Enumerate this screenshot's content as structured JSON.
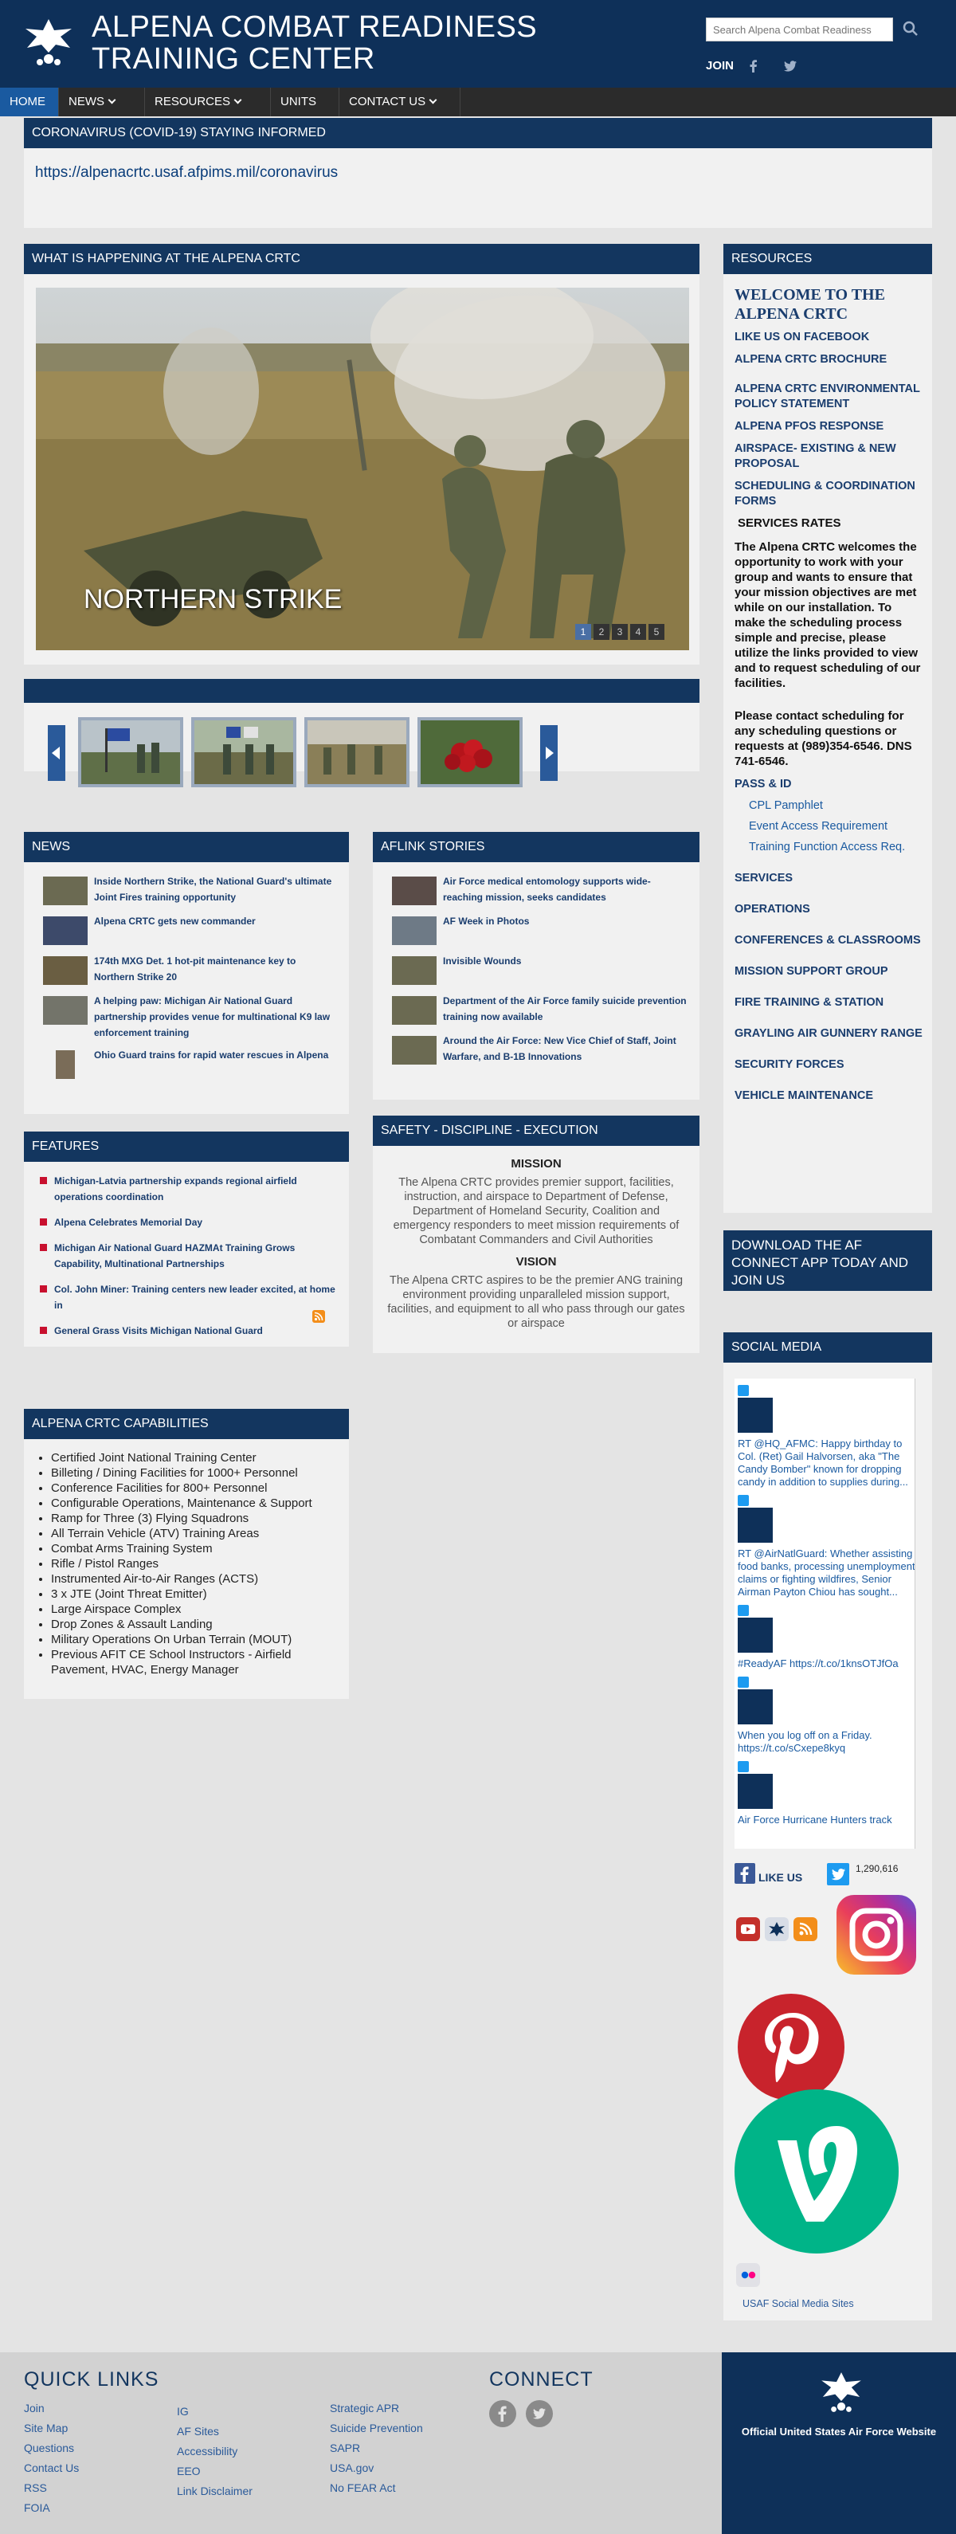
{
  "header": {
    "title": "ALPENA COMBAT READINESS TRAINING CENTER",
    "search_placeholder": "Search Alpena Combat Readiness",
    "join_label": "JOIN"
  },
  "nav": {
    "items": [
      {
        "label": "HOME",
        "active": true
      },
      {
        "label": "NEWS",
        "dropdown": true
      },
      {
        "label": "RESOURCES",
        "dropdown": true
      },
      {
        "label": "UNITS"
      },
      {
        "label": "CONTACT US",
        "dropdown": true
      }
    ]
  },
  "covid": {
    "heading": "CORONAVIRUS (COVID-19) STAYING INFORMED",
    "link": "https://alpenacrtc.usaf.afpims.mil/coronavirus"
  },
  "happening": {
    "heading": "WHAT IS HAPPENING AT THE ALPENA CRTC",
    "caption": "NORTHERN STRIKE",
    "pages": [
      "1",
      "2",
      "3",
      "4",
      "5"
    ]
  },
  "news": {
    "heading": "NEWS",
    "items": [
      "Inside Northern Strike, the National Guard's ultimate Joint Fires training opportunity",
      "Alpena CRTC gets new commander",
      "174th MXG Det. 1 hot-pit maintenance key to Northern Strike 20",
      "A helping paw: Michigan Air National Guard partnership provides venue for multinational K9 law enforcement training",
      "Ohio Guard trains for rapid water rescues in Alpena"
    ]
  },
  "aflink": {
    "heading": "AFLINK STORIES",
    "items": [
      "Air Force medical entomology supports wide-reaching mission, seeks candidates",
      "AF Week in Photos",
      "Invisible Wounds",
      "Department of the Air Force family suicide prevention training now available",
      "Around the Air Force: New Vice Chief of Staff, Joint Warfare, and B-1B Innovations"
    ]
  },
  "features": {
    "heading": "FEATURES",
    "items": [
      "Michigan-Latvia partnership expands regional airfield operations coordination",
      "Alpena Celebrates Memorial Day",
      "Michigan Air National Guard HAZMAt Training Grows Capability, Multinational Partnerships",
      "Col. John Miner: Training centers new leader excited, at home in",
      "General Grass Visits Michigan National Guard"
    ]
  },
  "safety": {
    "heading": "SAFETY - DISCIPLINE - EXECUTION",
    "mission_title": "MISSION",
    "mission_text": "The Alpena CRTC provides premier support, facilities, instruction, and airspace to Department of Defense, Department of Homeland Security, Coalition and emergency responders to meet mission requirements of Combatant Commanders and Civil Authorities",
    "vision_title": "VISION",
    "vision_text": "The Alpena CRTC aspires to be the premier ANG training environment providing unparalleled mission support, facilities, and equipment to all who pass through our gates or airspace"
  },
  "capabilities": {
    "heading": "ALPENA CRTC CAPABILITIES",
    "items": [
      "Certified Joint National Training Center",
      "Billeting / Dining Facilities for 1000+ Personnel",
      "Conference Facilities for 800+ Personnel",
      "Configurable Operations, Maintenance & Support",
      "Ramp for Three (3) Flying Squadrons",
      "All Terrain Vehicle (ATV) Training Areas",
      "Combat Arms Training System",
      "Rifle / Pistol Ranges",
      "Instrumented Air-to-Air Ranges (ACTS)",
      "3 x JTE (Joint Threat Emitter)",
      "Large Airspace Complex",
      "Drop Zones & Assault Landing",
      "Military Operations On Urban Terrain (MOUT)",
      "Previous AFIT CE School Instructors - Airfield Pavement, HVAC, Energy Manager"
    ]
  },
  "resources": {
    "heading": "RESOURCES",
    "welcome": "WELCOME TO THE ALPENA CRTC",
    "links_top": [
      "LIKE US ON  FACEBOOK",
      "ALPENA CRTC BROCHURE",
      "ALPENA CRTC ENVIRONMENTAL POLICY STATEMENT",
      "ALPENA PFOS RESPONSE",
      "AIRSPACE- EXISTING & NEW PROPOSAL",
      "SCHEDULING & COORDINATION FORMS"
    ],
    "services_rates": "SERVICES RATES",
    "welcome_para": "The Alpena CRTC welcomes the opportunity to work with your group and wants to ensure that your mission objectives are met while on our installation.  To make the scheduling process simple and precise, please utilize the links provided to view and to request scheduling of our facilities.",
    "contact_para": "Please contact scheduling for any scheduling questions or requests at (989)354-6546. DNS 741-6546.",
    "pass_id": "PASS & ID",
    "sub_links": [
      "CPL Pamphlet",
      "Event Access Requirement",
      "Training Function Access Req."
    ],
    "links_bottom": [
      "SERVICES",
      "OPERATIONS",
      "CONFERENCES & CLASSROOMS",
      "MISSION SUPPORT GROUP",
      "FIRE TRAINING & STATION",
      "GRAYLING AIR GUNNERY RANGE",
      "SECURITY FORCES",
      "VEHICLE MAINTENANCE"
    ]
  },
  "download": {
    "heading": "DOWNLOAD THE AF CONNECT APP TODAY AND JOIN US"
  },
  "social": {
    "heading": "SOCIAL MEDIA",
    "tweets": [
      "RT @HQ_AFMC: Happy birthday to Col. (Ret) Gail Halvorsen, aka \"The Candy Bomber\" known for dropping candy in addition to supplies during...",
      "RT @AirNatlGuard: Whether assisting food banks, processing unemployment claims or fighting wildfires, Senior Airman Payton Chiou has sought...",
      "#ReadyAF https://t.co/1knsOTJfOa",
      "When you log off on a Friday. https://t.co/sCxepe8kyq",
      "Air Force Hurricane Hunters track"
    ],
    "like_us": "LIKE US",
    "twitter_count": "1,290,616",
    "usaf_sites": "USAF Social Media Sites"
  },
  "footer": {
    "quick_links_heading": "QUICK LINKS",
    "col1": [
      "Join",
      "Site Map",
      "Questions",
      "Contact Us",
      "RSS",
      "FOIA"
    ],
    "col2": [
      "IG",
      "AF Sites",
      "Accessibility",
      "EEO",
      "Link Disclaimer"
    ],
    "col3": [
      "Strategic APR",
      "Suicide Prevention",
      "SAPR",
      "USA.gov",
      "No FEAR Act"
    ],
    "connect_heading": "CONNECT",
    "official": "Official United States Air Force Website"
  },
  "colors": {
    "navy": "#13365f",
    "header_navy": "#0e3059",
    "nav_dark": "#2b2b2b",
    "active_blue": "#1a5aa0",
    "link_blue": "#1a3d6e",
    "bullet_red": "#c8102e"
  }
}
